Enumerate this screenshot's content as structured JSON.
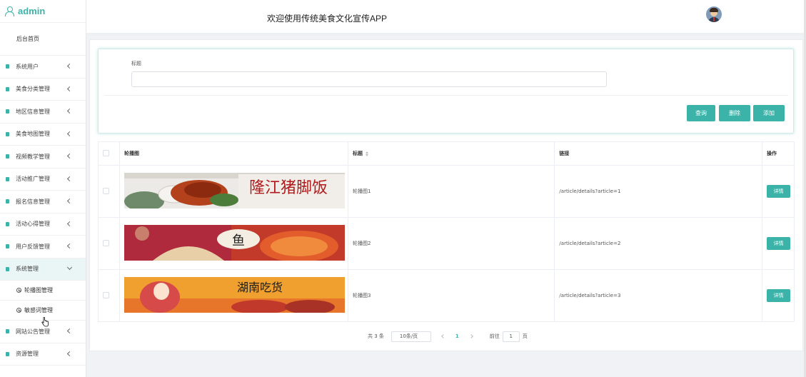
{
  "sidebar": {
    "brand": "admin",
    "home": "后台首页",
    "items": [
      {
        "label": "系统用户"
      },
      {
        "label": "美食分类管理"
      },
      {
        "label": "地区信息管理"
      },
      {
        "label": "美食地图管理"
      },
      {
        "label": "视频教学管理"
      },
      {
        "label": "活动推广管理"
      },
      {
        "label": "报名信息管理"
      },
      {
        "label": "活动心得管理"
      },
      {
        "label": "用户反馈管理"
      },
      {
        "label": "系统管理"
      },
      {
        "label": "网站公告管理"
      },
      {
        "label": "资源管理"
      }
    ],
    "subitems": [
      {
        "label": "轮播图管理"
      },
      {
        "label": "敏感词管理"
      }
    ]
  },
  "header": {
    "title": "欢迎使用传统美食文化宣传APP"
  },
  "search": {
    "label": "标题",
    "placeholder": ""
  },
  "buttons": {
    "query": "查询",
    "delete": "删除",
    "add": "添加"
  },
  "table": {
    "columns": [
      "轮播图",
      "标题",
      "链接",
      "操作"
    ],
    "rows": [
      {
        "title": "轮播图1",
        "link": "/article/details?article=1",
        "action": "详情",
        "banner_text": "隆江猪脚饭"
      },
      {
        "title": "轮播图2",
        "link": "/article/details?article=2",
        "action": "详情",
        "banner_text": "鱼"
      },
      {
        "title": "轮播图3",
        "link": "/article/details?article=3",
        "action": "详情",
        "banner_text": "湖南吃货"
      }
    ]
  },
  "pagination": {
    "total": "共 3 条",
    "page_size": "10条/页",
    "current_page": "1",
    "goto_label": "前往",
    "goto_value": "1",
    "page_unit": "页"
  },
  "colors": {
    "accent": "#3bb3a8"
  }
}
